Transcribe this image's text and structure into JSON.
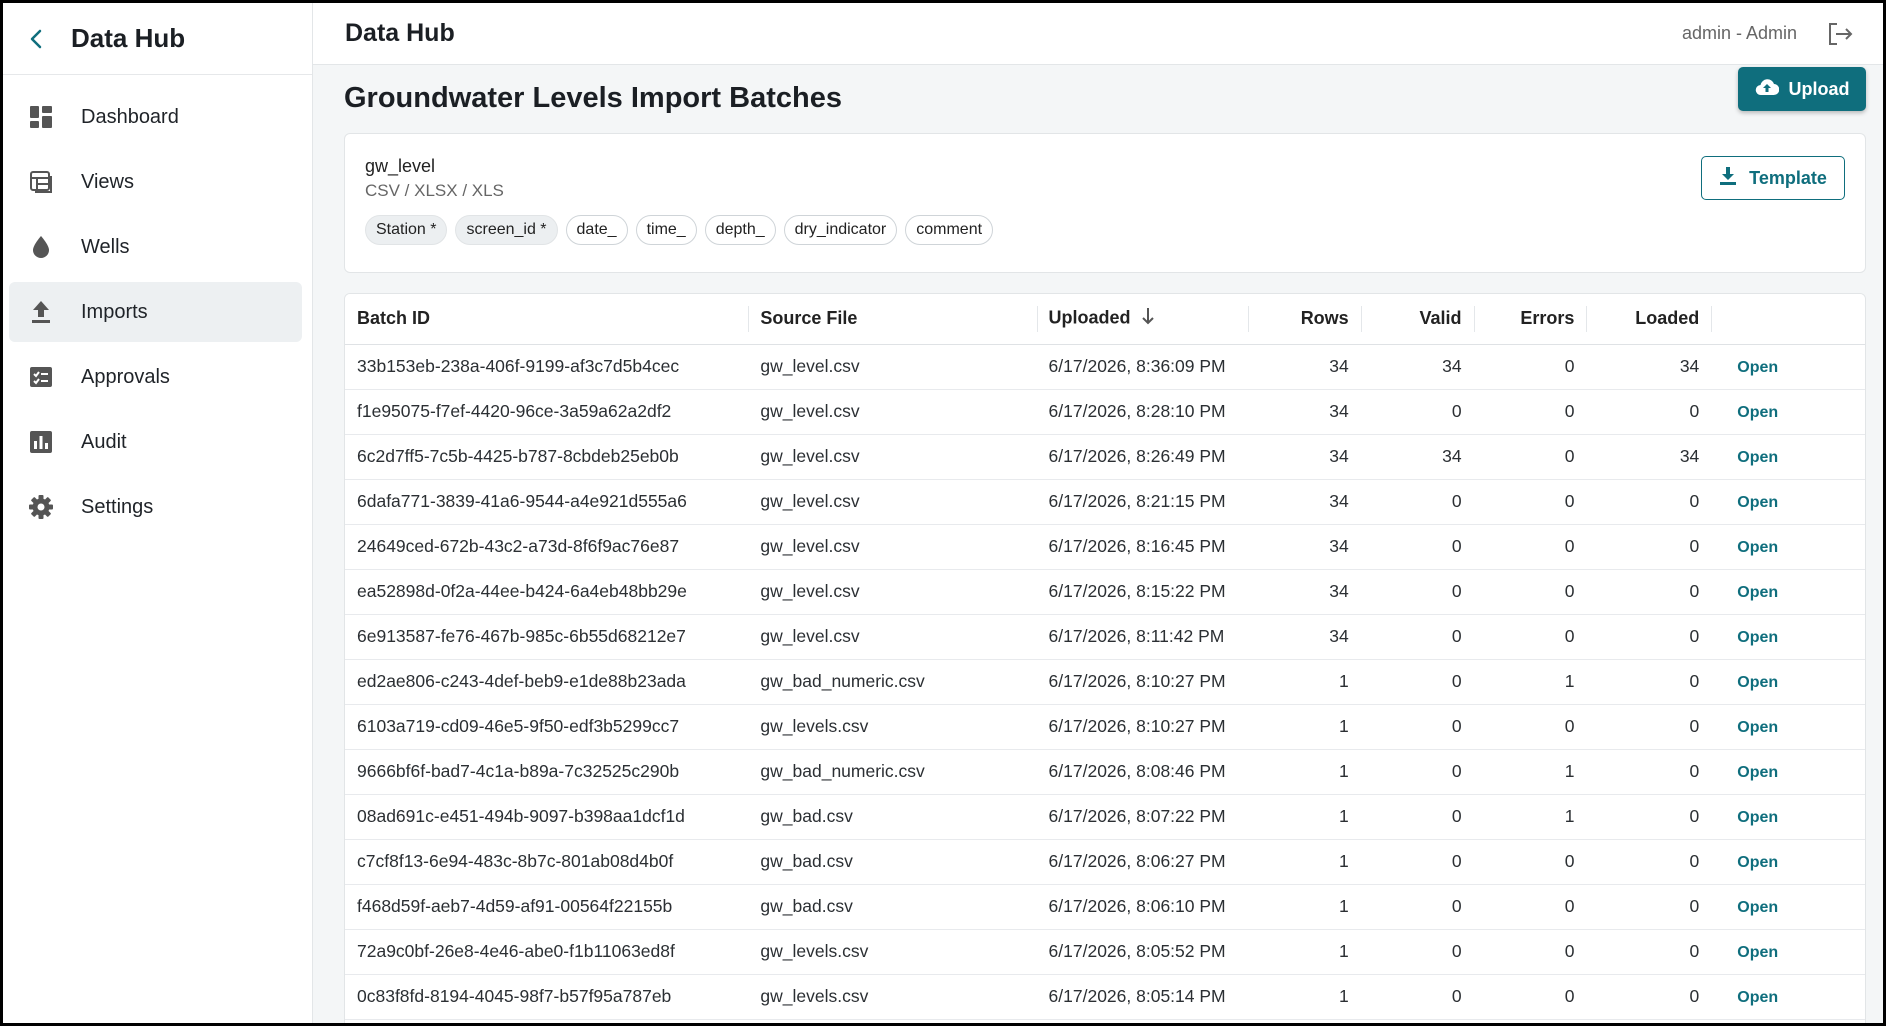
{
  "sidebar": {
    "title": "Data Hub",
    "items": [
      {
        "label": "Dashboard",
        "icon": "dashboard-icon"
      },
      {
        "label": "Views",
        "icon": "views-icon"
      },
      {
        "label": "Wells",
        "icon": "droplet-icon"
      },
      {
        "label": "Imports",
        "icon": "upload-icon",
        "active": true
      },
      {
        "label": "Approvals",
        "icon": "approval-icon"
      },
      {
        "label": "Audit",
        "icon": "bar-chart-icon"
      },
      {
        "label": "Settings",
        "icon": "gear-icon"
      }
    ]
  },
  "topbar": {
    "title": "Data Hub",
    "user": "admin - Admin"
  },
  "page": {
    "title": "Groundwater Levels Import Batches",
    "upload_label": "Upload"
  },
  "schema": {
    "name": "gw_level",
    "formats": "CSV / XLSX / XLS",
    "template_label": "Template",
    "fields": [
      "Station *",
      "screen_id *",
      "date_",
      "time_",
      "depth_",
      "dry_indicator",
      "comment"
    ]
  },
  "table": {
    "headers": {
      "batch_id": "Batch ID",
      "source_file": "Source File",
      "uploaded": "Uploaded",
      "rows": "Rows",
      "valid": "Valid",
      "errors": "Errors",
      "loaded": "Loaded"
    },
    "action_label": "Open",
    "rows": [
      [
        "33b153eb-238a-406f-9199-af3c7d5b4cec",
        "gw_level.csv",
        "6/17/2026, 8:36:09 PM",
        "34",
        "34",
        "0",
        "34"
      ],
      [
        "f1e95075-f7ef-4420-96ce-3a59a62a2df2",
        "gw_level.csv",
        "6/17/2026, 8:28:10 PM",
        "34",
        "0",
        "0",
        "0"
      ],
      [
        "6c2d7ff5-7c5b-4425-b787-8cbdeb25eb0b",
        "gw_level.csv",
        "6/17/2026, 8:26:49 PM",
        "34",
        "34",
        "0",
        "34"
      ],
      [
        "6dafa771-3839-41a6-9544-a4e921d555a6",
        "gw_level.csv",
        "6/17/2026, 8:21:15 PM",
        "34",
        "0",
        "0",
        "0"
      ],
      [
        "24649ced-672b-43c2-a73d-8f6f9ac76e87",
        "gw_level.csv",
        "6/17/2026, 8:16:45 PM",
        "34",
        "0",
        "0",
        "0"
      ],
      [
        "ea52898d-0f2a-44ee-b424-6a4eb48bb29e",
        "gw_level.csv",
        "6/17/2026, 8:15:22 PM",
        "34",
        "0",
        "0",
        "0"
      ],
      [
        "6e913587-fe76-467b-985c-6b55d68212e7",
        "gw_level.csv",
        "6/17/2026, 8:11:42 PM",
        "34",
        "0",
        "0",
        "0"
      ],
      [
        "ed2ae806-c243-4def-beb9-e1de88b23ada",
        "gw_bad_numeric.csv",
        "6/17/2026, 8:10:27 PM",
        "1",
        "0",
        "1",
        "0"
      ],
      [
        "6103a719-cd09-46e5-9f50-edf3b5299cc7",
        "gw_levels.csv",
        "6/17/2026, 8:10:27 PM",
        "1",
        "0",
        "0",
        "0"
      ],
      [
        "9666bf6f-bad7-4c1a-b89a-7c32525c290b",
        "gw_bad_numeric.csv",
        "6/17/2026, 8:08:46 PM",
        "1",
        "0",
        "1",
        "0"
      ],
      [
        "08ad691c-e451-494b-9097-b398aa1dcf1d",
        "gw_bad.csv",
        "6/17/2026, 8:07:22 PM",
        "1",
        "0",
        "1",
        "0"
      ],
      [
        "c7cf8f13-6e94-483c-8b7c-801ab08d4b0f",
        "gw_bad.csv",
        "6/17/2026, 8:06:27 PM",
        "1",
        "0",
        "0",
        "0"
      ],
      [
        "f468d59f-aeb7-4d59-af91-00564f22155b",
        "gw_bad.csv",
        "6/17/2026, 8:06:10 PM",
        "1",
        "0",
        "0",
        "0"
      ],
      [
        "72a9c0bf-26e8-4e46-abe0-f1b11063ed8f",
        "gw_levels.csv",
        "6/17/2026, 8:05:52 PM",
        "1",
        "0",
        "0",
        "0"
      ],
      [
        "0c83f8fd-8194-4045-98f7-b57f95a787eb",
        "gw_levels.csv",
        "6/17/2026, 8:05:14 PM",
        "1",
        "0",
        "0",
        "0"
      ]
    ]
  },
  "colors": {
    "accent": "#0f6e7d",
    "active_nav": "#edf0f2"
  }
}
